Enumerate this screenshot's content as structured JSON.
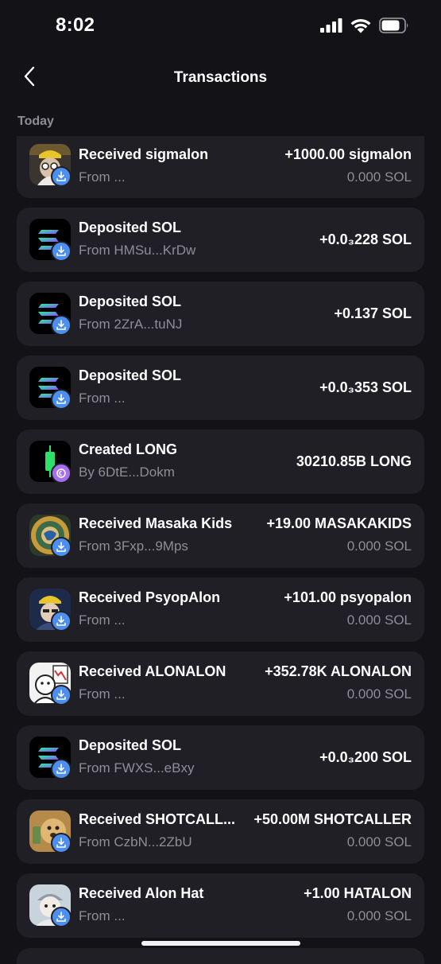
{
  "status_bar": {
    "time": "8:02"
  },
  "header": {
    "title": "Transactions"
  },
  "section": {
    "label": "Today"
  },
  "transactions": [
    {
      "title": "Received sigmalon",
      "subtitle": "From ...",
      "amount": "+1000.00 sigmalon",
      "value": "0.000 SOL",
      "icon": "sigmalon-token-icon",
      "badge": "download-icon"
    },
    {
      "title": "Deposited SOL",
      "subtitle": "From HMSu...KrDw",
      "amount": "+0.0₃228 SOL",
      "value": "",
      "icon": "solana-icon",
      "badge": "download-icon"
    },
    {
      "title": "Deposited SOL",
      "subtitle": "From 2ZrA...tuNJ",
      "amount": "+0.137 SOL",
      "value": "",
      "icon": "solana-icon",
      "badge": "download-icon"
    },
    {
      "title": "Deposited SOL",
      "subtitle": "From ...",
      "amount": "+0.0₃353 SOL",
      "value": "",
      "icon": "solana-icon",
      "badge": "download-icon"
    },
    {
      "title": "Created LONG",
      "subtitle": "By 6DtE...Dokm",
      "amount": "30210.85B LONG",
      "value": "",
      "icon": "long-token-icon",
      "badge": "create-icon"
    },
    {
      "title": "Received Masaka Kids",
      "subtitle": "From 3Fxp...9Mps",
      "amount": "+19.00 MASAKAKIDS",
      "value": "0.000 SOL",
      "icon": "masakakids-token-icon",
      "badge": "download-icon"
    },
    {
      "title": "Received PsyopAlon",
      "subtitle": "From ...",
      "amount": "+101.00 psyopalon",
      "value": "0.000 SOL",
      "icon": "psyopalon-token-icon",
      "badge": "download-icon"
    },
    {
      "title": "Received ALONALON",
      "subtitle": "From ...",
      "amount": "+352.78K ALONALON",
      "value": "0.000 SOL",
      "icon": "alonalon-token-icon",
      "badge": "download-icon"
    },
    {
      "title": "Deposited SOL",
      "subtitle": "From FWXS...eBxy",
      "amount": "+0.0₃200 SOL",
      "value": "",
      "icon": "solana-icon",
      "badge": "download-icon"
    },
    {
      "title": "Received SHOTCALL...",
      "subtitle": "From CzbN...2ZbU",
      "amount": "+50.00M SHOTCALLER",
      "value": "0.000 SOL",
      "icon": "shotcaller-token-icon",
      "badge": "download-icon"
    },
    {
      "title": "Received Alon Hat",
      "subtitle": "From ...",
      "amount": "+1.00 HATALON",
      "value": "0.000 SOL",
      "icon": "hatalon-token-icon",
      "badge": "download-icon"
    }
  ],
  "colors": {
    "background": "#121217",
    "card": "#1f1f25",
    "text_primary": "#ffffff",
    "text_secondary": "#8e8e98",
    "badge_blue": "#4d8ff0",
    "badge_purple": "#a66ff0"
  }
}
